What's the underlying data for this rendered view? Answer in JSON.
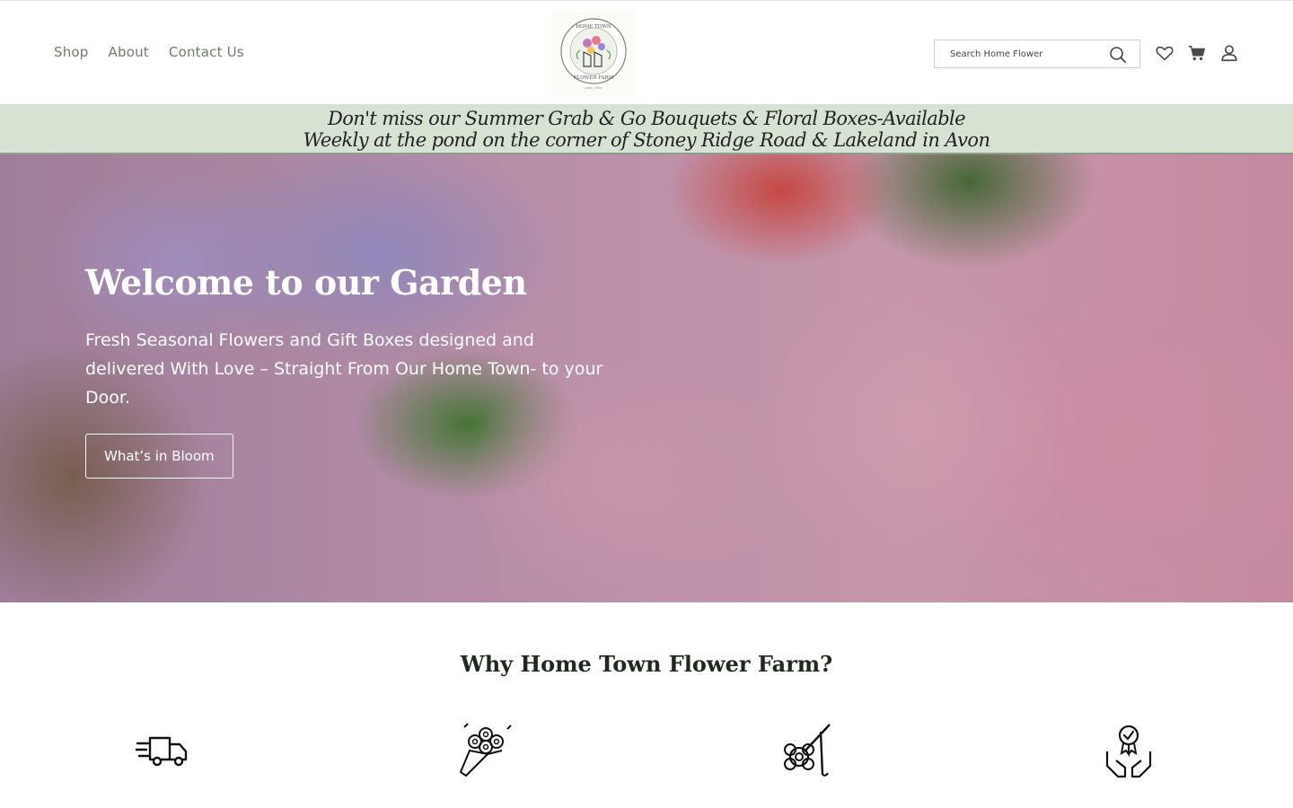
{
  "nav": {
    "items": [
      {
        "label": "Shop"
      },
      {
        "label": "About"
      },
      {
        "label": "Contact Us"
      }
    ]
  },
  "logo": {
    "text_top": "HOME TOWN",
    "text_bottom": "FLOWER FARM",
    "text_small": "Avon, Ohio"
  },
  "search": {
    "placeholder": "Search Home Flower"
  },
  "header_icons": [
    "heart-icon",
    "cart-icon",
    "user-icon"
  ],
  "banner": {
    "line1": "Don't miss our Summer Grab & Go Bouquets & Floral Boxes-Available",
    "line2": "Weekly at the pond on the corner of Stoney Ridge Road & Lakeland in Avon"
  },
  "hero": {
    "title": "Welcome to our Garden",
    "subtitle": "Fresh Seasonal Flowers and Gift Boxes designed and delivered With Love – Straight From Our Home Town- to your Door.",
    "button_label": "What’s in Bloom"
  },
  "why": {
    "title": "Why Home Town Flower Farm?",
    "features": [
      {
        "icon": "delivery-truck-icon"
      },
      {
        "icon": "bouquet-icon"
      },
      {
        "icon": "flower-tools-icon"
      },
      {
        "icon": "quality-badge-hands-icon"
      }
    ]
  },
  "colors": {
    "nav_text": "#6d7f64",
    "banner_bg": "#d6e3d2",
    "heading": "#1f2a1f"
  }
}
